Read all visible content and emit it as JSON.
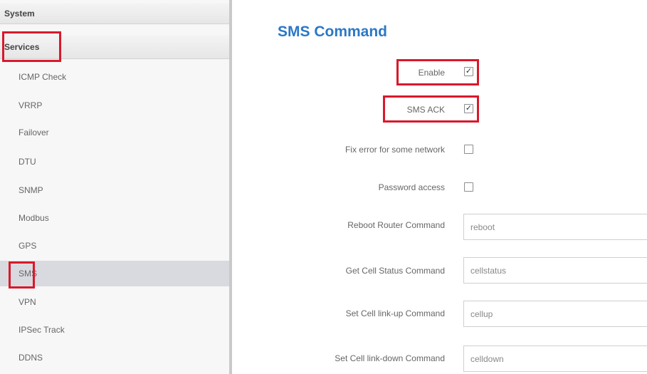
{
  "sidebar": {
    "system_label": "System",
    "services_label": "Services",
    "items": [
      {
        "label": "ICMP Check"
      },
      {
        "label": "VRRP"
      },
      {
        "label": "Failover"
      },
      {
        "label": "DTU"
      },
      {
        "label": "SNMP"
      },
      {
        "label": "Modbus"
      },
      {
        "label": "GPS"
      },
      {
        "label": "SMS",
        "active": true
      },
      {
        "label": "VPN"
      },
      {
        "label": "IPSec Track"
      },
      {
        "label": "DDNS"
      }
    ]
  },
  "main": {
    "title": "SMS Command",
    "fields": {
      "enable": {
        "label": "Enable",
        "checked": true
      },
      "sms_ack": {
        "label": "SMS ACK",
        "checked": true
      },
      "fix_error": {
        "label": "Fix error for some network",
        "checked": false
      },
      "password_access": {
        "label": "Password access",
        "checked": false
      },
      "reboot": {
        "label": "Reboot Router Command",
        "value": "reboot"
      },
      "cell_status": {
        "label": "Get Cell Status Command",
        "value": "cellstatus"
      },
      "cell_up": {
        "label": "Set Cell link-up Command",
        "value": "cellup"
      },
      "cell_down": {
        "label": "Set Cell link-down Command",
        "value": "celldown"
      }
    }
  },
  "colors": {
    "title": "#2b78c6",
    "highlight": "#d9192b",
    "active_item_bg": "#d9dae0"
  }
}
